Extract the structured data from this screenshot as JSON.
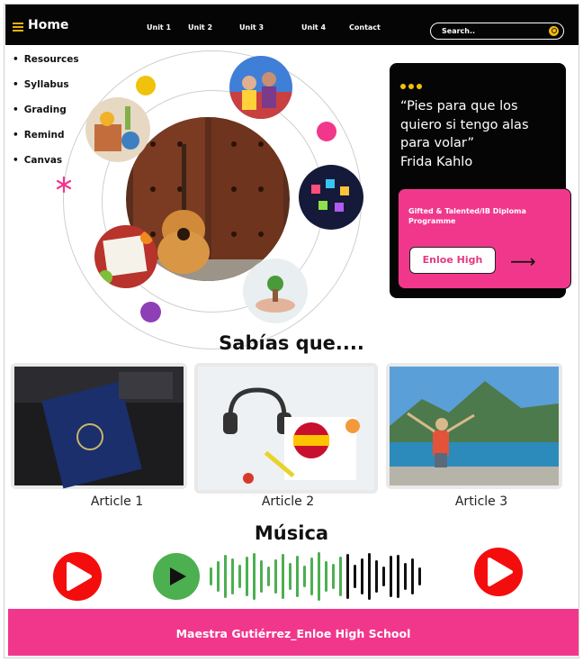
{
  "nav": {
    "home_label": "Home",
    "links": [
      "Unit 1",
      "Unit 2",
      "Unit 3",
      "Unit 4",
      "Contact"
    ],
    "search_placeholder": "Search.."
  },
  "sidebar": {
    "items": [
      "Resources",
      "Syllabus",
      "Grading",
      "Remind",
      "Canvas"
    ]
  },
  "quote": {
    "text": "“Pies para que los quiero si tengo alas para volar”",
    "author": "Frida Kahlo"
  },
  "promo": {
    "title": "Gifted & Talented/IB Diploma Programme",
    "button_label": "Enloe High"
  },
  "articles_section": {
    "heading": "Sabías que....",
    "articles": [
      "Article 1",
      "Article 2",
      "Article 3"
    ]
  },
  "music_section": {
    "heading": "Música"
  },
  "footer": {
    "text": "Maestra Gutiérrez_Enloe High School"
  },
  "colors": {
    "nav_bg": "#050505",
    "accent_yellow": "#f0c20c",
    "accent_pink": "#f1378c",
    "play_red": "#f40d0d",
    "play_green": "#4caf50"
  }
}
